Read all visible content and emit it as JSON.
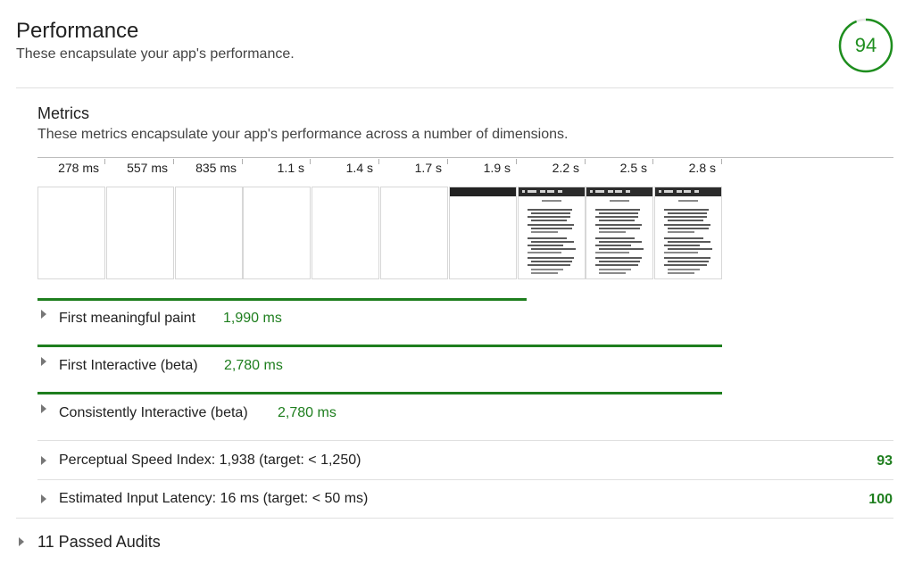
{
  "category": {
    "title": "Performance",
    "description": "These encapsulate your app's performance.",
    "score": "94",
    "score_fraction": 0.94,
    "score_color": "#1e8e1e"
  },
  "metrics": {
    "title": "Metrics",
    "description": "These metrics encapsulate your app's performance across a number of dimensions.",
    "filmstrip": [
      {
        "time": "278 ms",
        "state": "blank"
      },
      {
        "time": "557 ms",
        "state": "blank"
      },
      {
        "time": "835 ms",
        "state": "blank"
      },
      {
        "time": "1.1 s",
        "state": "blank"
      },
      {
        "time": "1.4 s",
        "state": "blank"
      },
      {
        "time": "1.7 s",
        "state": "blank"
      },
      {
        "time": "1.9 s",
        "state": "header-only"
      },
      {
        "time": "2.2 s",
        "state": "loaded"
      },
      {
        "time": "2.5 s",
        "state": "loaded"
      },
      {
        "time": "2.8 s",
        "state": "loaded"
      }
    ],
    "timeline_items": [
      {
        "label": "First meaningful paint",
        "value": "1,990 ms"
      },
      {
        "label": "First Interactive (beta)",
        "value": "2,780 ms"
      },
      {
        "label": "Consistently Interactive (beta)",
        "value": "2,780 ms"
      }
    ],
    "scored_items": [
      {
        "label": "Perceptual Speed Index: 1,938 (target: < 1,250)",
        "score": "93"
      },
      {
        "label": "Estimated Input Latency: 16 ms (target: < 50 ms)",
        "score": "100"
      }
    ]
  },
  "passed_audits": {
    "label": "11 Passed Audits"
  },
  "colors": {
    "pass": "#1e7e1e",
    "divider": "#e0e0e0"
  }
}
